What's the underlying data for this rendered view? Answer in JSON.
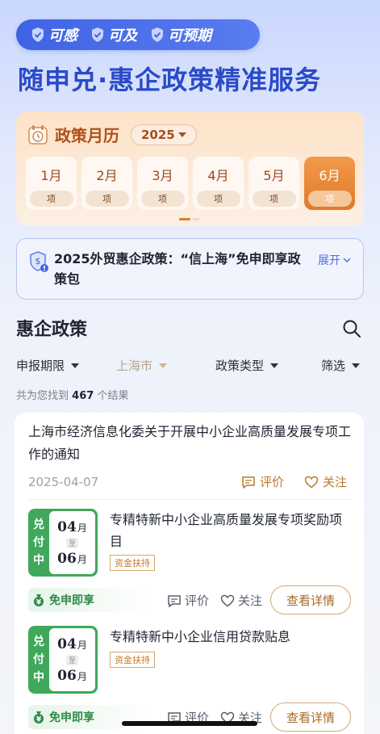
{
  "header": {
    "slogans": [
      "可感",
      "可及",
      "可预期"
    ],
    "title": "随申兑·惠企政策精准服务"
  },
  "calendar": {
    "title": "政策月历",
    "year": "2025",
    "months": [
      {
        "label": "1月",
        "sub": "项",
        "active": false
      },
      {
        "label": "2月",
        "sub": "项",
        "active": false
      },
      {
        "label": "3月",
        "sub": "项",
        "active": false
      },
      {
        "label": "4月",
        "sub": "项",
        "active": false
      },
      {
        "label": "5月",
        "sub": "项",
        "active": false
      },
      {
        "label": "6月",
        "sub": "项",
        "active": true
      }
    ]
  },
  "banner": {
    "text": "2025外贸惠企政策：“信上海”免申即享政策包",
    "expand_label": "展开"
  },
  "section": {
    "title": "惠企政策"
  },
  "filters": {
    "items": [
      "申报期限",
      "上海市",
      "政策类型",
      "筛选"
    ]
  },
  "results": {
    "prefix": "共为您找到",
    "count": "467",
    "suffix": "个结果"
  },
  "card": {
    "title": "上海市经济信息化委关于开展中小企业高质量发展专项工作的通知",
    "date": "2025-04-07",
    "comment_label": "评价",
    "follow_label": "关注",
    "items": [
      {
        "status": [
          "兑",
          "付",
          "中"
        ],
        "start_day": "04",
        "start_unit": "月",
        "to": "至",
        "end_day": "06",
        "end_unit": "月",
        "title": "专精特新中小企业高质量发展专项奖励项目",
        "tag": "资金扶持",
        "free": "免申即享",
        "comment": "评价",
        "follow": "关注",
        "detail": "查看详情"
      },
      {
        "status": [
          "兑",
          "付",
          "中"
        ],
        "start_day": "04",
        "start_unit": "月",
        "to": "至",
        "end_day": "06",
        "end_unit": "月",
        "title": "专精特新中小企业信用贷款贴息",
        "tag": "资金扶持",
        "free": "免申即享",
        "comment": "评价",
        "follow": "关注",
        "detail": "查看详情"
      }
    ]
  },
  "colors": {
    "brand_blue": "#3f63e6",
    "accent_orange": "#e07a2a",
    "status_green": "#3fa85a",
    "gold": "#b87a2e"
  }
}
